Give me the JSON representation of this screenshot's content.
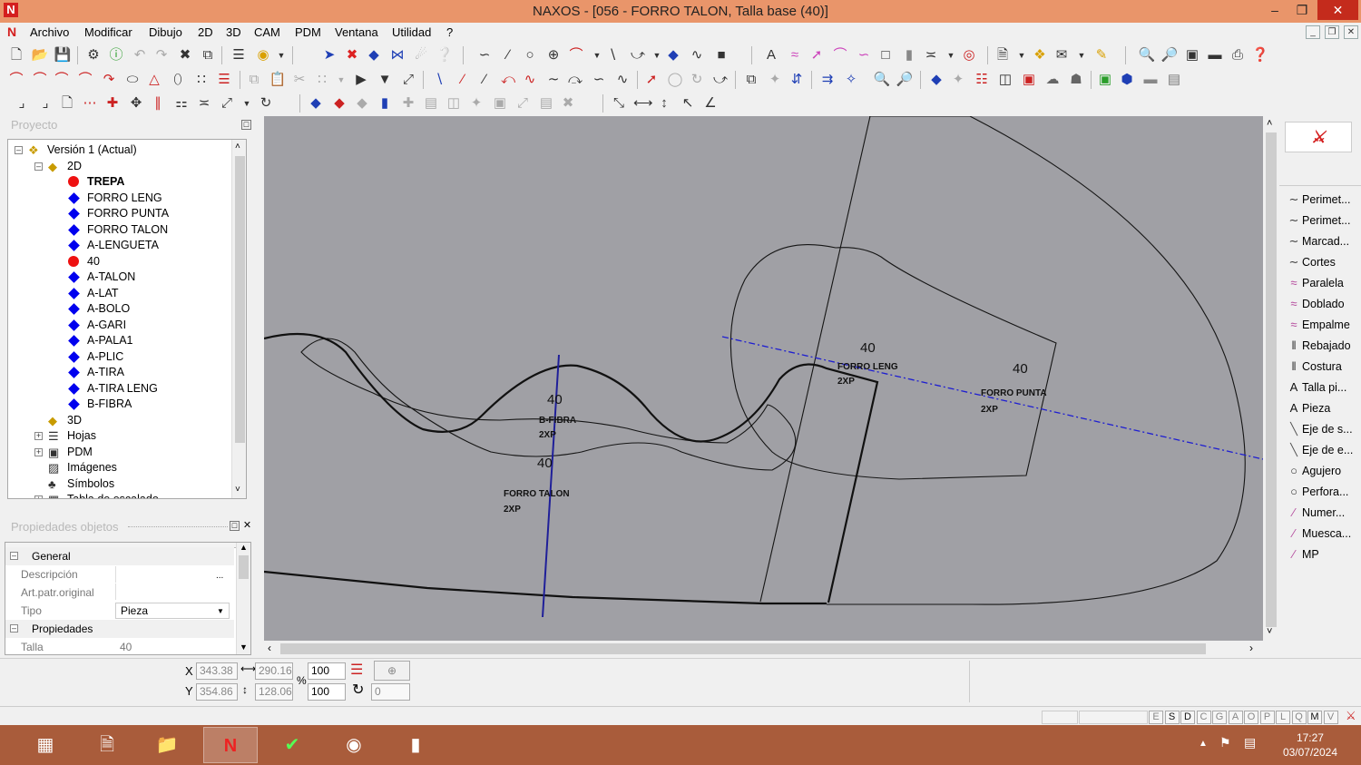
{
  "window": {
    "title": "NAXOS - [056 - FORRO TALON, Talla base (40)]",
    "app_icon": "N"
  },
  "menu": [
    "Archivo",
    "Modificar",
    "Dibujo",
    "2D",
    "3D",
    "CAM",
    "PDM",
    "Ventana",
    "Utilidad",
    "?"
  ],
  "project_panel": {
    "title": "Proyecto",
    "tree": [
      {
        "label": "Versión 1 (Actual)",
        "icon": "version-icon"
      },
      {
        "label": "2D",
        "icon": "layer-icon"
      },
      {
        "label": "TREPA",
        "icon": "red-dot",
        "bold": true
      },
      {
        "label": "FORRO LENG",
        "icon": "blue-diamond"
      },
      {
        "label": "FORRO PUNTA",
        "icon": "blue-diamond"
      },
      {
        "label": "FORRO TALON",
        "icon": "blue-diamond"
      },
      {
        "label": "A-LENGUETA",
        "icon": "blue-diamond"
      },
      {
        "label": "40",
        "icon": "red-dot"
      },
      {
        "label": "A-TALON",
        "icon": "blue-diamond"
      },
      {
        "label": "A-LAT",
        "icon": "blue-diamond"
      },
      {
        "label": "A-BOLO",
        "icon": "blue-diamond"
      },
      {
        "label": "A-GARI",
        "icon": "blue-diamond"
      },
      {
        "label": "A-PALA1",
        "icon": "blue-diamond"
      },
      {
        "label": "A-PLIC",
        "icon": "blue-diamond"
      },
      {
        "label": "A-TIRA",
        "icon": "blue-diamond"
      },
      {
        "label": "A-TIRA LENG",
        "icon": "blue-diamond"
      },
      {
        "label": "B-FIBRA",
        "icon": "blue-diamond"
      },
      {
        "label": "3D",
        "icon": "layer-icon"
      },
      {
        "label": "Hojas",
        "icon": "sheets-icon"
      },
      {
        "label": "PDM",
        "icon": "folder-icon"
      },
      {
        "label": "Imágenes",
        "icon": "images-icon"
      },
      {
        "label": "Símbolos",
        "icon": "symbols-icon"
      },
      {
        "label": "Tabla de escalado",
        "icon": "table-icon"
      }
    ]
  },
  "properties_panel": {
    "title": "Propiedades objetos",
    "sections": {
      "general": "General",
      "properties": "Propiedades"
    },
    "fields": {
      "descripcion": {
        "label": "Descripción",
        "value": ""
      },
      "art_patr": {
        "label": "Art.patr.original",
        "value": ""
      },
      "tipo": {
        "label": "Tipo",
        "value": "Pieza"
      },
      "talla": {
        "label": "Talla",
        "value": "40"
      }
    },
    "ellipsis": "..."
  },
  "canvas": {
    "pieces": [
      {
        "size": "40",
        "name": "FORRO LENG",
        "qty": "2XP"
      },
      {
        "size": "40",
        "name": "FORRO PUNTA",
        "qty": "2XP"
      },
      {
        "size": "40",
        "name": "B-FIBRA",
        "qty": "2XP"
      },
      {
        "size": "40",
        "name": "FORRO TALON",
        "qty": "2XP"
      }
    ]
  },
  "right_tools": [
    "Perimet...",
    "Perimet...",
    "Marcad...",
    "Cortes",
    "Paralela",
    "Doblado",
    "Empalme",
    "Rebajado",
    "Costura",
    "Talla pi...",
    "Pieza",
    "Eje de s...",
    "Eje de e...",
    "Agujero",
    "Perfora...",
    "Numer...",
    "Muesca...",
    "MP"
  ],
  "coords": {
    "x_label": "X",
    "y_label": "Y",
    "x": "343.38",
    "y": "354.86",
    "w": "290.16",
    "h": "128.06",
    "sx": "100",
    "sy": "100",
    "pct": "%",
    "rot": "0"
  },
  "status_letters": [
    "E",
    "S",
    "D",
    "C",
    "G",
    "A",
    "O",
    "P",
    "L",
    "Q",
    "M",
    "V"
  ],
  "taskbar": {
    "time": "17:27",
    "date": "03/07/2024"
  }
}
